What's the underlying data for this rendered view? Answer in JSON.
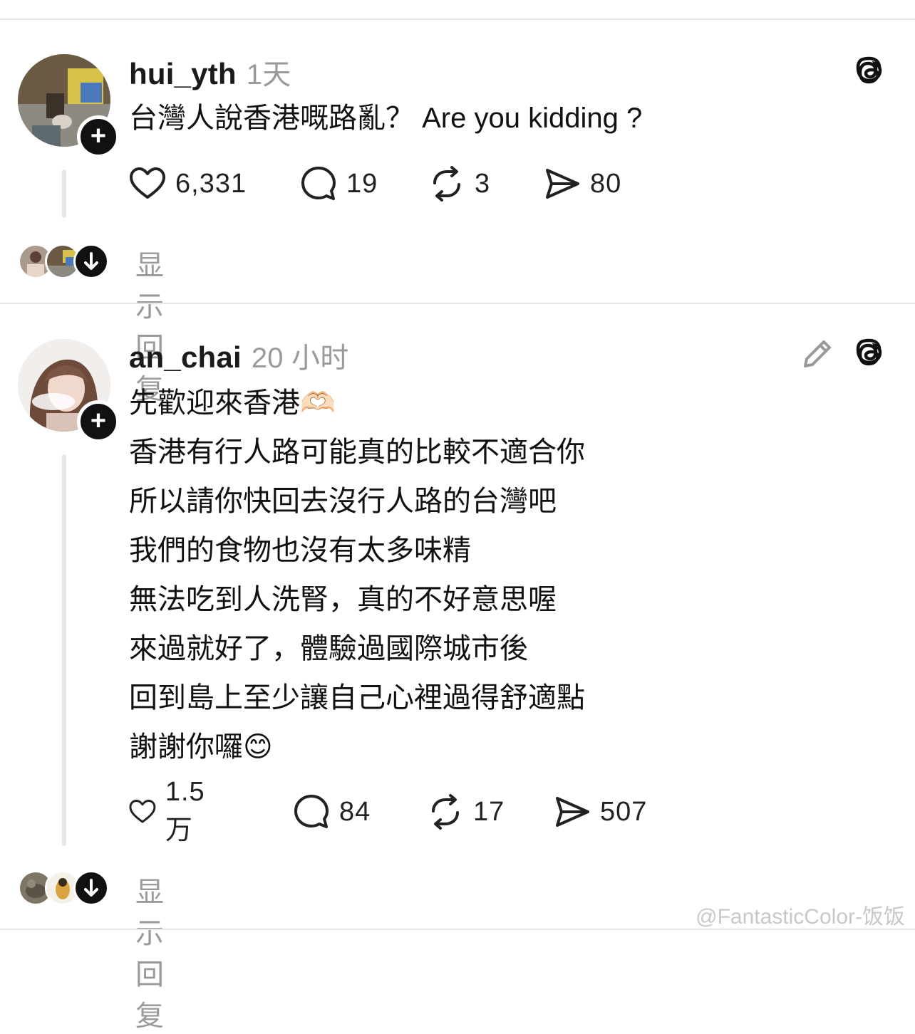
{
  "posts": [
    {
      "username": "hui_yth",
      "time": "1天",
      "lines": [
        "台灣人說香港嘅路亂？ Are you kidding ?"
      ],
      "likes": "6,331",
      "comments": "19",
      "reposts": "3",
      "shares": "80",
      "show_replies": "显示回复"
    },
    {
      "username": "an_chai",
      "time": "20 小时",
      "lines": [
        "先歡迎來香港🫶🏻",
        "香港有行人路可能真的比較不適合你",
        "所以請你快回去沒行人路的台灣吧",
        "我們的食物也沒有太多味精",
        "無法吃到人洗腎，真的不好意思喔",
        "來過就好了，體驗過國際城市後",
        "回到島上至少讓自己心裡過得舒適點",
        "謝謝你囉😊"
      ],
      "likes": "1.5万",
      "comments": "84",
      "reposts": "17",
      "shares": "507",
      "show_replies": "显示回复"
    }
  ],
  "watermark": "@FantasticColor-饭饭",
  "icons": {
    "follow": "plus-icon",
    "like": "heart-icon",
    "comment": "comment-bubble-icon",
    "repost": "repost-icon",
    "share": "send-icon",
    "threads": "threads-logo-icon",
    "edit": "pencil-icon",
    "down": "arrow-down-icon"
  }
}
